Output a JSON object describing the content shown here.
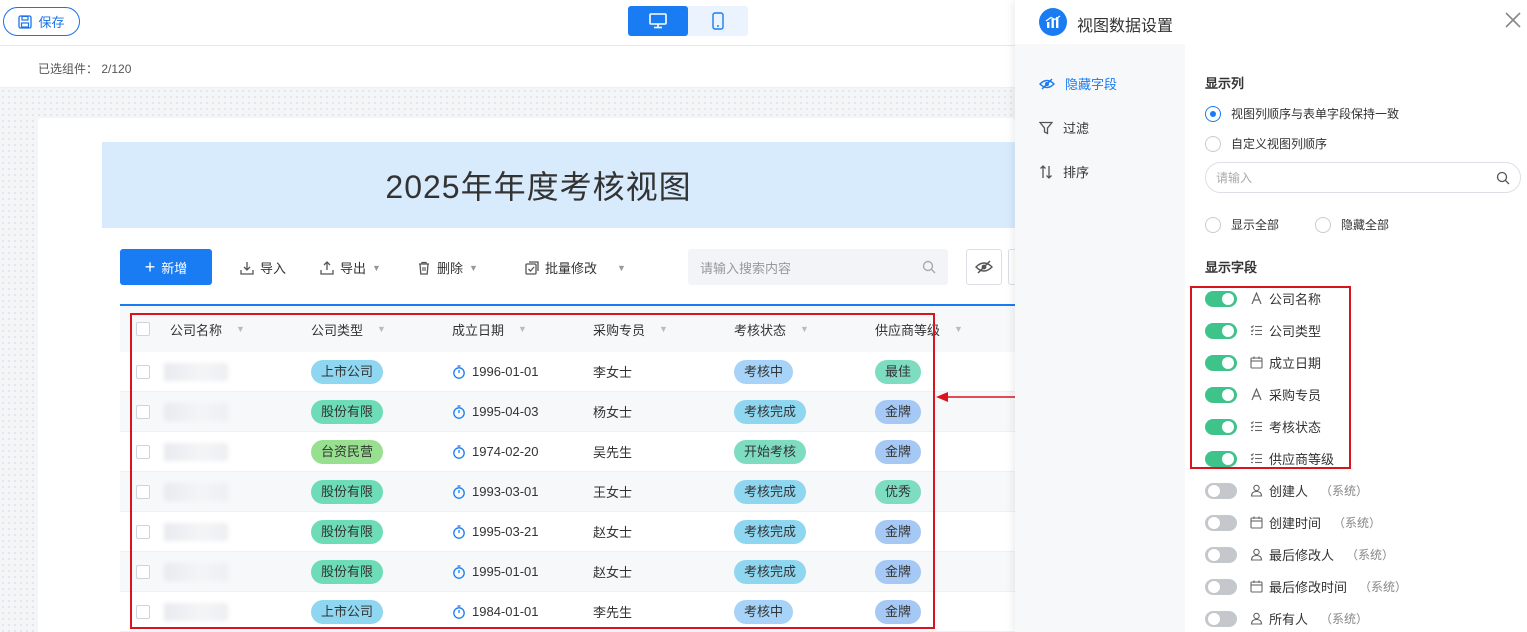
{
  "toolbar_top": {
    "save_label": "保存",
    "selected_components": "已选组件： 2/120"
  },
  "view": {
    "title": "2025年年度考核视图",
    "new_label": "新增",
    "import_label": "导入",
    "export_label": "导出",
    "delete_label": "删除",
    "batch_edit_label": "批量修改",
    "search_placeholder": "请输入搜索内容"
  },
  "table": {
    "columns": [
      "公司名称",
      "公司类型",
      "成立日期",
      "采购专员",
      "考核状态",
      "供应商等级"
    ],
    "rows": [
      {
        "type": "上市公司",
        "type_color": "#8fd6f0",
        "date": "1996-01-01",
        "person": "李女士",
        "status": "考核中",
        "status_color": "#a6d3f7",
        "grade": "最佳",
        "grade_color": "#7edcc0"
      },
      {
        "type": "股份有限",
        "type_color": "#6fdcb8",
        "date": "1995-04-03",
        "person": "杨女士",
        "status": "考核完成",
        "status_color": "#8fd6f0",
        "grade": "金牌",
        "grade_color": "#a6c8f4"
      },
      {
        "type": "台资民营",
        "type_color": "#96e08f",
        "date": "1974-02-20",
        "person": "吴先生",
        "status": "开始考核",
        "status_color": "#7edcc0",
        "grade": "金牌",
        "grade_color": "#a6c8f4"
      },
      {
        "type": "股份有限",
        "type_color": "#6fdcb8",
        "date": "1993-03-01",
        "person": "王女士",
        "status": "考核完成",
        "status_color": "#8fd6f0",
        "grade": "优秀",
        "grade_color": "#7edcc0"
      },
      {
        "type": "股份有限",
        "type_color": "#6fdcb8",
        "date": "1995-03-21",
        "person": "赵女士",
        "status": "考核完成",
        "status_color": "#8fd6f0",
        "grade": "金牌",
        "grade_color": "#a6c8f4"
      },
      {
        "type": "股份有限",
        "type_color": "#6fdcb8",
        "date": "1995-01-01",
        "person": "赵女士",
        "status": "考核完成",
        "status_color": "#8fd6f0",
        "grade": "金牌",
        "grade_color": "#a6c8f4"
      },
      {
        "type": "上市公司",
        "type_color": "#8fd6f0",
        "date": "1984-01-01",
        "person": "李先生",
        "status": "考核中",
        "status_color": "#a6d3f7",
        "grade": "金牌",
        "grade_color": "#a6c8f4"
      }
    ]
  },
  "panel": {
    "title": "视图数据设置",
    "nav": [
      "隐藏字段",
      "过滤",
      "排序"
    ],
    "show_columns_title": "显示列",
    "option_keep_order": "视图列顺序与表单字段保持一致",
    "option_custom_order": "自定义视图列顺序",
    "search_placeholder": "请输入",
    "show_all": "显示全部",
    "hide_all": "隐藏全部",
    "show_fields_title": "显示字段",
    "fields": [
      {
        "label": "公司名称",
        "icon": "text-icon",
        "on": true,
        "sys": ""
      },
      {
        "label": "公司类型",
        "icon": "list-icon",
        "on": true,
        "sys": ""
      },
      {
        "label": "成立日期",
        "icon": "calendar-icon",
        "on": true,
        "sys": ""
      },
      {
        "label": "采购专员",
        "icon": "text-icon",
        "on": true,
        "sys": ""
      },
      {
        "label": "考核状态",
        "icon": "list-icon",
        "on": true,
        "sys": ""
      },
      {
        "label": "供应商等级",
        "icon": "list-icon",
        "on": true,
        "sys": ""
      },
      {
        "label": "创建人",
        "icon": "user-icon",
        "on": false,
        "sys": "（系统）"
      },
      {
        "label": "创建时间",
        "icon": "calendar-icon",
        "on": false,
        "sys": "（系统）"
      },
      {
        "label": "最后修改人",
        "icon": "user-icon",
        "on": false,
        "sys": "（系统）"
      },
      {
        "label": "最后修改时间",
        "icon": "calendar-icon",
        "on": false,
        "sys": "（系统）"
      },
      {
        "label": "所有人",
        "icon": "user-icon",
        "on": false,
        "sys": "（系统）"
      }
    ]
  },
  "colors": {
    "accent": "#1a7cf3",
    "highlight": "#d9141f",
    "switch_on": "#3ec48a"
  }
}
